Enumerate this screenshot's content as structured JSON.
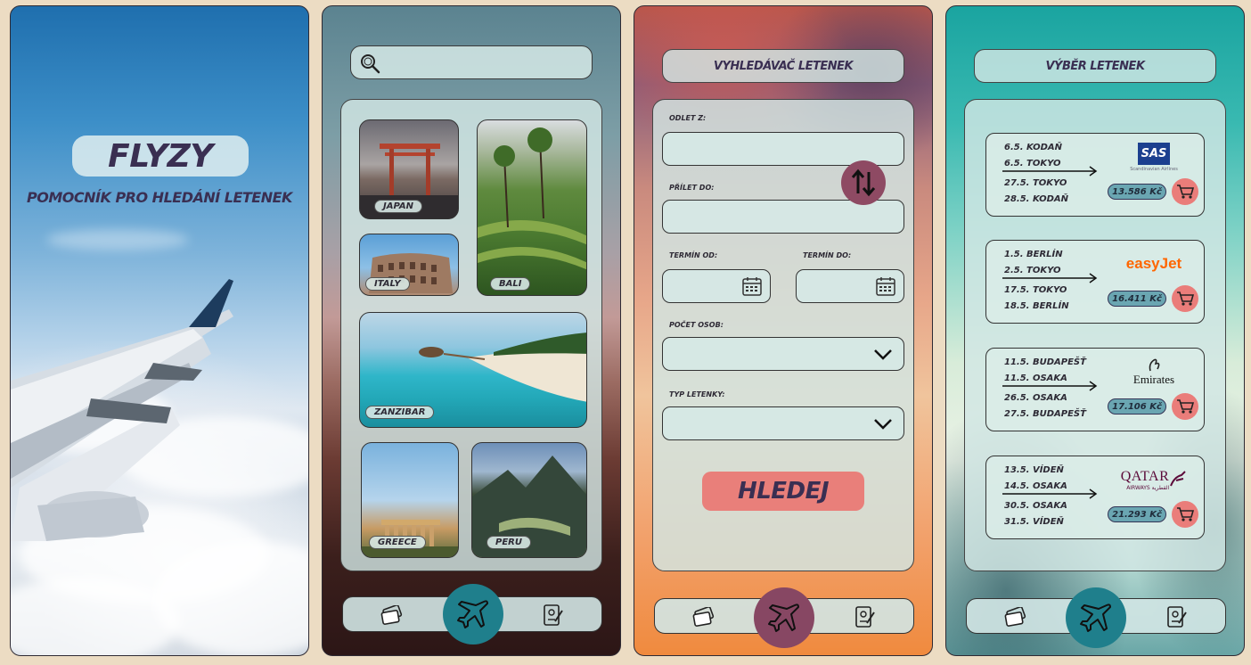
{
  "screen1": {
    "app_title": "FLYZY",
    "subtitle": "POMOCNÍK PRO HLEDÁNÍ LETENEK"
  },
  "screen2": {
    "search": {
      "placeholder": ""
    },
    "destinations": [
      {
        "label": "JAPAN"
      },
      {
        "label": "BALI"
      },
      {
        "label": "ITALY"
      },
      {
        "label": "ZANZIBAR"
      },
      {
        "label": "GREECE"
      },
      {
        "label": "PERU"
      }
    ]
  },
  "screen3": {
    "header": "VYHLEDÁVAČ LETENEK",
    "from_label": "ODLET Z:",
    "to_label": "PŘÍLET DO:",
    "date_from_label": "TERMÍN OD:",
    "date_to_label": "TERMÍN DO:",
    "passengers_label": "POČET OSOB:",
    "ticket_type_label": "TYP LETENKY:",
    "search_button": "HLEDEJ"
  },
  "screen4": {
    "header": "VÝBĚR LETENEK",
    "flights": [
      {
        "lines": [
          "6.5. KODAŇ",
          "6.5. TOKYO",
          "27.5. TOKYO",
          "28.5. KODAŇ"
        ],
        "price": "13.586 Kč",
        "airline": "SAS",
        "airline_sub": "Scandinavian Airlines"
      },
      {
        "lines": [
          "1.5. BERLÍN",
          "2.5. TOKYO",
          "17.5. TOKYO",
          "18.5. BERLÍN"
        ],
        "price": "16.411 Kč",
        "airline": "easyJet"
      },
      {
        "lines": [
          "11.5. BUDAPEŠŤ",
          "11.5. OSAKA",
          "26.5. OSAKA",
          "27.5. BUDAPEŠŤ"
        ],
        "price": "17.106 Kč",
        "airline": "Emirates"
      },
      {
        "lines": [
          "13.5. VÍDEŇ",
          "14.5. OSAKA",
          "30.5. OSAKA",
          "31.5. VÍDEŇ"
        ],
        "price": "21.293 Kč",
        "airline": "QATAR",
        "airline_sub": "AIRWAYS القطرية"
      }
    ]
  },
  "colors": {
    "fab_teal": "#1f7f8c",
    "fab_plum": "#874763",
    "accent_coral": "#e97f7a",
    "price_pill": "#6aa6b2",
    "text_dark": "#3a2f52"
  }
}
